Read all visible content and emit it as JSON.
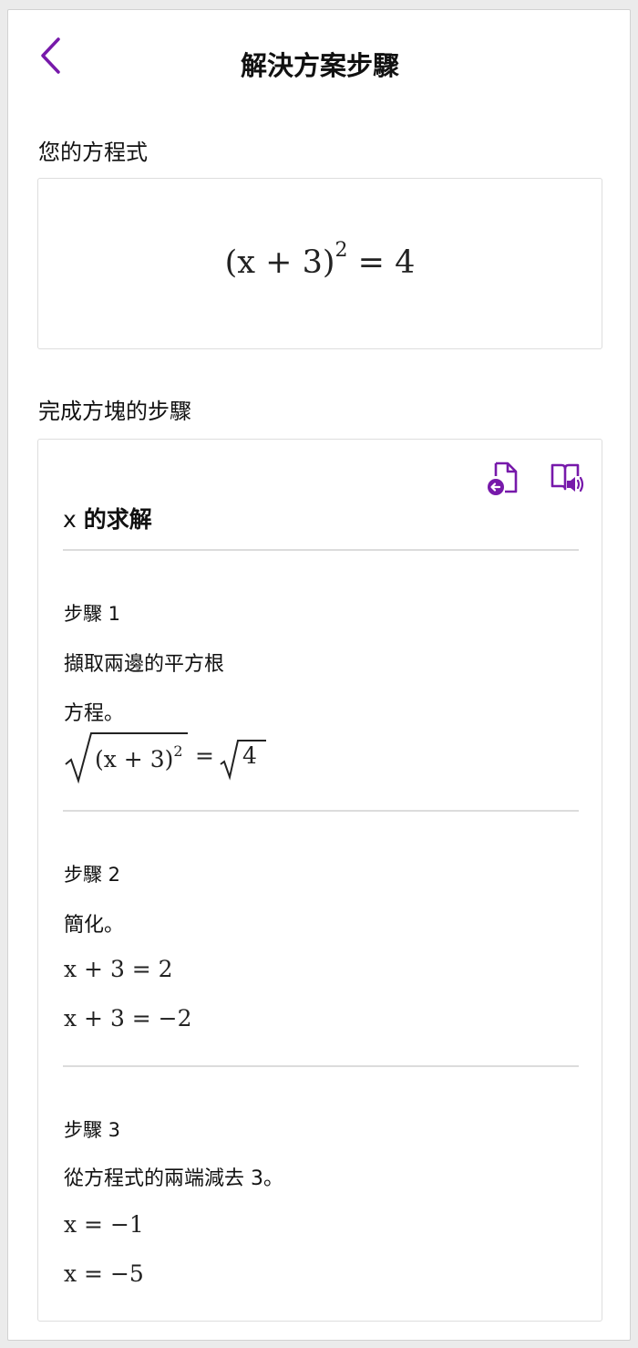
{
  "header": {
    "back_icon": "chevron-left-icon",
    "title": "解決方案步驟"
  },
  "colors": {
    "accent": "#7719aa",
    "divider": "#dcdcdc",
    "card_border": "#dddddd"
  },
  "equation_section": {
    "label": "您的方程式",
    "base": "(x + 3)",
    "exponent": "2",
    "rhs": "= 4"
  },
  "steps_section": {
    "label": "完成方塊的步驟",
    "icons": [
      "document-back-icon",
      "immersive-reader-icon"
    ],
    "solve_prefix": "x",
    "solve_title": "的求解",
    "steps": [
      {
        "label": "步驟 1",
        "text_lines": [
          "擷取兩邊的平方根",
          "方程。"
        ],
        "math": {
          "radicand": "(x + 3)",
          "exponent": "2",
          "equals": "=",
          "rhs": "4"
        }
      },
      {
        "label": "步驟 2",
        "text_lines": [
          "簡化。"
        ],
        "math_lines": [
          "x + 3 = 2",
          "x + 3 = −2"
        ]
      },
      {
        "label": "步驟 3",
        "text_lines": [
          "從方程式的兩端減去 3。"
        ],
        "math_lines": [
          "x = −1",
          "x = −5"
        ]
      }
    ]
  }
}
